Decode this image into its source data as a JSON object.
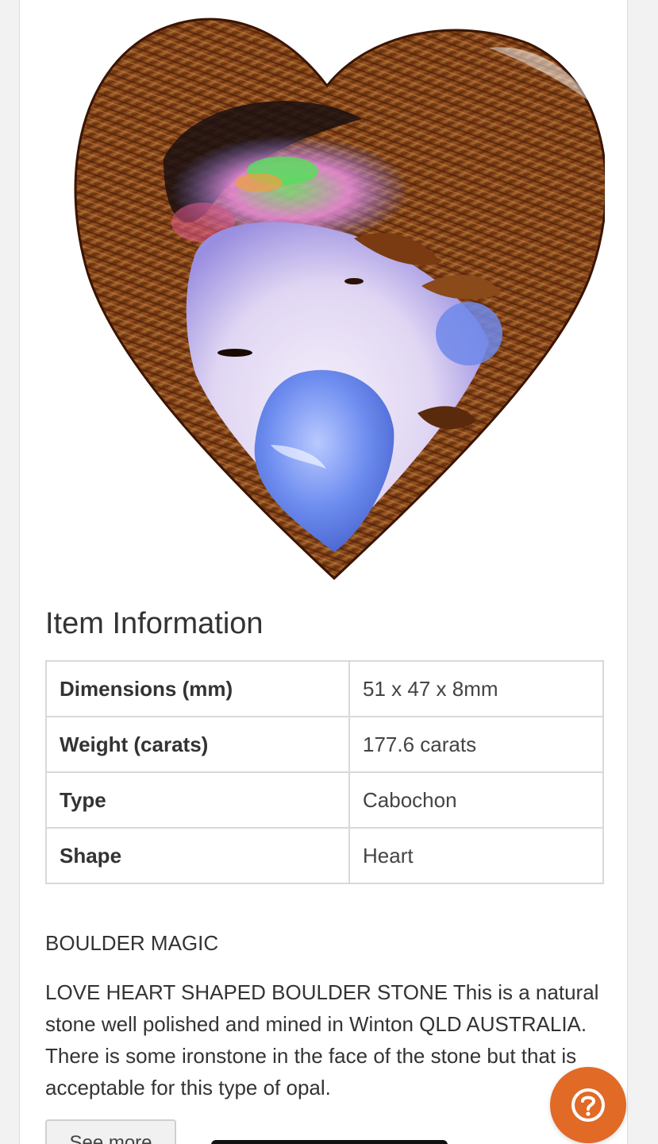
{
  "item_info": {
    "title": "Item Information",
    "rows": [
      {
        "label": "Dimensions (mm)",
        "value": "51 x 47 x 8mm"
      },
      {
        "label": "Weight (carats)",
        "value": "177.6 carats"
      },
      {
        "label": "Type",
        "value": "Cabochon"
      },
      {
        "label": "Shape",
        "value": "Heart"
      }
    ]
  },
  "description": {
    "heading": "BOULDER MAGIC",
    "body": "LOVE HEART SHAPED BOULDER STONE This is a natural stone well polished and mined in Winton QLD AUSTRALIA. There is some ironstone in the face of the stone but that is acceptable for this type of opal."
  },
  "buttons": {
    "see_more": "See more"
  },
  "icons": {
    "help": "question-mark-icon"
  },
  "colors": {
    "help_button": "#e06a26",
    "ironstone": "#7a3a12",
    "opal_blue": "#5b7bdc"
  }
}
